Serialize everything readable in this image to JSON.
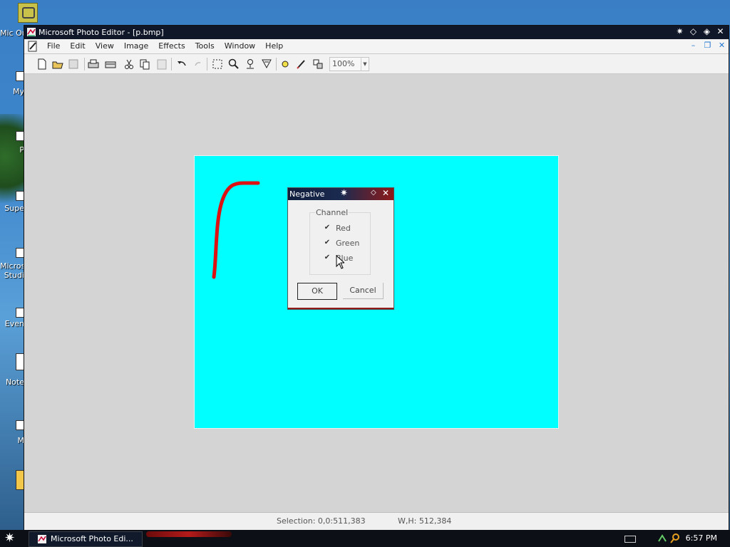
{
  "window": {
    "title": "Microsoft Photo Editor - [p.bmp]",
    "title_buttons": [
      "help-star",
      "pin",
      "resize",
      "close"
    ]
  },
  "menu": {
    "items": [
      "File",
      "Edit",
      "View",
      "Image",
      "Effects",
      "Tools",
      "Window",
      "Help"
    ]
  },
  "toolbar": {
    "zoom_value": "100%",
    "tools": [
      "new",
      "open",
      "save",
      "print",
      "scan",
      "cut",
      "copy",
      "paste",
      "undo",
      "redo",
      "select",
      "zoom",
      "smudge",
      "sharpen",
      "balance",
      "paint",
      "transparent"
    ]
  },
  "dialog": {
    "title": "Negative",
    "group_title": "Channel",
    "channels": [
      {
        "label": "Red",
        "checked": true
      },
      {
        "label": "Green",
        "checked": true
      },
      {
        "label": "Blue",
        "checked": true
      }
    ],
    "ok_label": "OK",
    "cancel_label": "Cancel"
  },
  "canvas": {
    "background_color": "#00ffff",
    "stroke_color": "#dd1111"
  },
  "status": {
    "selection": "Selection: 0,0:511,383",
    "size": "W,H: 512,384"
  },
  "desktop": {
    "icons": [
      {
        "label": "Mic\nOu"
      },
      {
        "label": "My"
      },
      {
        "label": "P"
      },
      {
        "label": "Supe"
      },
      {
        "label": "Microsc\nStudi"
      },
      {
        "label": "Even"
      },
      {
        "label": "Note"
      },
      {
        "label": "M"
      }
    ]
  },
  "taskbar": {
    "task_label": "Microsoft Photo Edi...",
    "clock": "6:57 PM"
  }
}
